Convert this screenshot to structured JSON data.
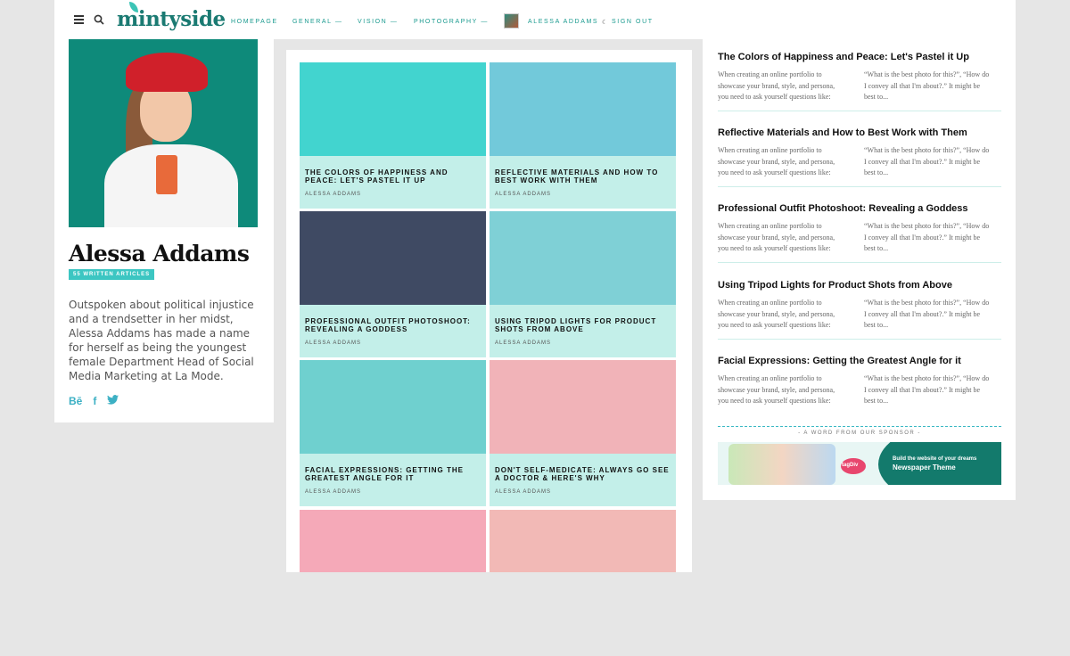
{
  "header": {
    "logo": "mintyside",
    "nav": [
      {
        "label": "HOMEPAGE"
      },
      {
        "label": "GENERAL —"
      },
      {
        "label": "VISION —"
      },
      {
        "label": "PHOTOGRAPHY —"
      }
    ],
    "user_name": "ALESSA ADDAMS",
    "sign_out": "SIGN OUT"
  },
  "author": {
    "name": "Alessa Addams",
    "articles_badge": "55 WRITTEN ARTICLES",
    "bio": "Outspoken about political injustice and a trendsetter in her midst, Alessa Addams has made a name for herself as being the youngest female Department Head of Social Media Marketing at La Mode.",
    "socials": [
      "Bē",
      "f",
      "🐦"
    ]
  },
  "grid": [
    {
      "title": "THE COLORS OF HAPPINESS AND PEACE: LET'S PASTEL IT UP",
      "author": "ALESSA ADDAMS",
      "color": "#42d4cf"
    },
    {
      "title": "REFLECTIVE MATERIALS AND HOW TO BEST WORK WITH THEM",
      "author": "ALESSA ADDAMS",
      "color": "#72c9da"
    },
    {
      "title": "PROFESSIONAL OUTFIT PHOTOSHOOT: REVEALING A GODDESS",
      "author": "ALESSA ADDAMS",
      "color": "#3f4a63"
    },
    {
      "title": "USING TRIPOD LIGHTS FOR PRODUCT SHOTS FROM ABOVE",
      "author": "ALESSA ADDAMS",
      "color": "#7fd0d6"
    },
    {
      "title": "FACIAL EXPRESSIONS: GETTING THE GREATEST ANGLE FOR IT",
      "author": "ALESSA ADDAMS",
      "color": "#6fd0cf"
    },
    {
      "title": "DON'T SELF-MEDICATE: ALWAYS GO SEE A DOCTOR & HERE'S WHY",
      "author": "ALESSA ADDAMS",
      "color": "#f1b3b8"
    },
    {
      "title": "",
      "author": "",
      "color": "#f5a9b8"
    },
    {
      "title": "",
      "author": "",
      "color": "#f2b9b6"
    }
  ],
  "sidebar": {
    "posts": [
      {
        "title": "The Colors of Happiness and Peace: Let's Pastel it Up",
        "col1": "When creating an online portfolio to showcase your brand, style, and persona, you need to ask yourself questions like:",
        "col2": "“What is the best photo for this?”, “How do I convey all that I'm about?.” It might be best to..."
      },
      {
        "title": "Reflective Materials and How to Best Work with Them",
        "col1": "When creating an online portfolio to showcase your brand, style, and persona, you need to ask yourself questions like:",
        "col2": "“What is the best photo for this?”, “How do I convey all that I'm about?.” It might be best to..."
      },
      {
        "title": "Professional Outfit Photoshoot: Revealing a Goddess",
        "col1": "When creating an online portfolio to showcase your brand, style, and persona, you need to ask yourself questions like:",
        "col2": "“What is the best photo for this?”, “How do I convey all that I'm about?.” It might be best to..."
      },
      {
        "title": "Using Tripod Lights for Product Shots from Above",
        "col1": "When creating an online portfolio to showcase your brand, style, and persona, you need to ask yourself questions like:",
        "col2": "“What is the best photo for this?”, “How do I convey all that I'm about?.” It might be best to..."
      },
      {
        "title": "Facial Expressions: Getting the Greatest Angle for it",
        "col1": "When creating an online portfolio to showcase your brand, style, and persona, you need to ask yourself questions like:",
        "col2": "“What is the best photo for this?”, “How do I convey all that I'm about?.” It might be best to..."
      }
    ],
    "sponsor_label": "- A WORD FROM OUR SPONSOR -",
    "banner": {
      "tag": "tagDiv",
      "line1": "Build the website of your dreams",
      "line2": "Newspaper Theme"
    }
  }
}
